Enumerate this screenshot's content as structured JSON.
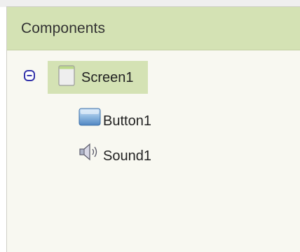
{
  "panel": {
    "title": "Components"
  },
  "tree": {
    "collapse_icon": "collapse-minus-icon",
    "root": {
      "label": "Screen1",
      "icon": "screen-icon",
      "selected": true
    },
    "children": [
      {
        "label": "Button1",
        "icon": "button-icon"
      },
      {
        "label": "Sound1",
        "icon": "sound-icon"
      }
    ]
  },
  "colors": {
    "header_bg": "#d4e2b4",
    "panel_bg": "#f8f8f1",
    "selected_bg": "#d4e2b4",
    "toggle_blue": "#3333aa"
  }
}
